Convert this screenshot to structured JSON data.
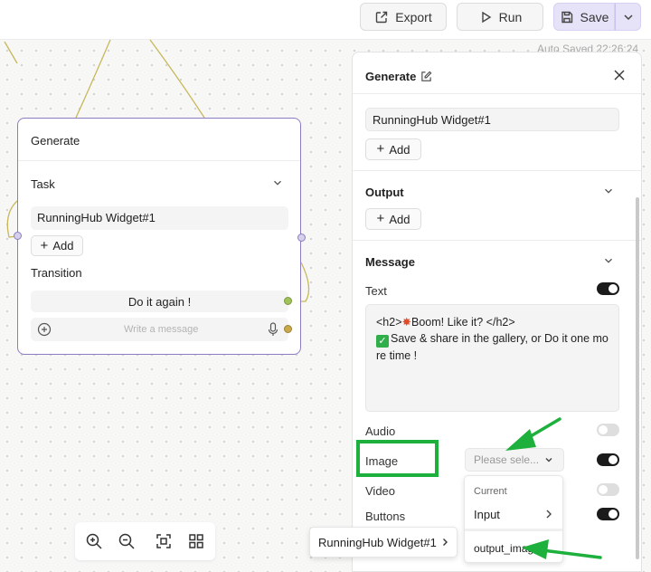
{
  "toolbar": {
    "export_label": "Export",
    "run_label": "Run",
    "save_label": "Save"
  },
  "autosave_text": "Auto Saved 22:26:24",
  "node": {
    "title": "Generate",
    "task_label": "Task",
    "task_value": "RunningHub Widget#1",
    "add_label": "Add",
    "transition_label": "Transition",
    "transition_value": "Do it again !",
    "message_placeholder": "Write a message"
  },
  "panel": {
    "title": "Generate",
    "task_value": "RunningHub Widget#1",
    "add_label": "Add",
    "output_header": "Output",
    "output_add_label": "Add",
    "message_header": "Message",
    "text_label": "Text",
    "message_line1_pre": "<h2>",
    "message_line1_post": "Boom! Like it? </h2>",
    "message_line2": "Save & share in the gallery, or Do it one more time !",
    "audio_label": "Audio",
    "image_label": "Image",
    "image_select_placeholder": "Please sele...",
    "video_label": "Video",
    "buttons_label": "Buttons",
    "toggles": {
      "text": true,
      "audio": false,
      "image": true,
      "video": false,
      "buttons": true
    }
  },
  "dropdown": {
    "current_label": "Current",
    "input_label": "Input",
    "output_label": "output_image"
  },
  "flyout": {
    "label": "RunningHub Widget#1"
  },
  "colors": {
    "node_border": "#8d7cc4",
    "save_button_bg": "#e6e3f8",
    "annotation_green": "#1eb03c",
    "edge_color": "#c7b85c"
  }
}
